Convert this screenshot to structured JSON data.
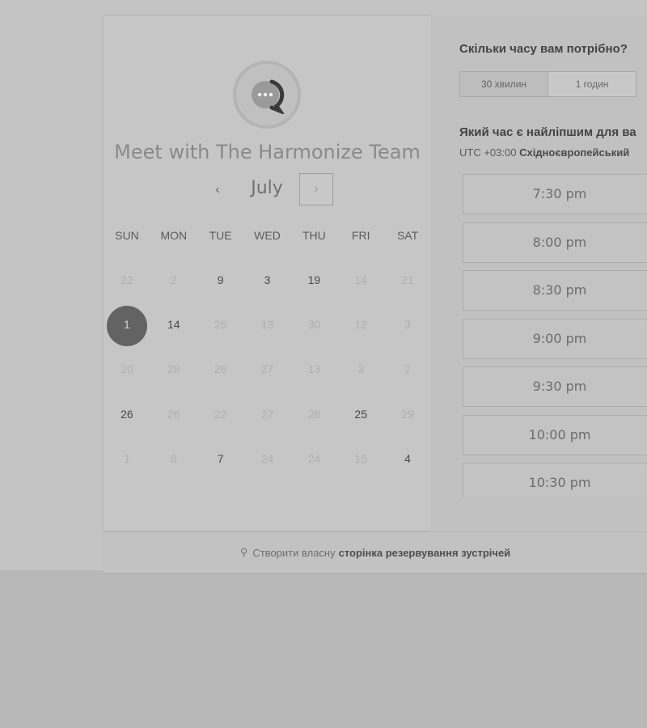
{
  "meeting": {
    "title": "Meet with The Harmonize Team"
  },
  "calendar": {
    "month": "July",
    "prev_label": "‹",
    "next_label": "›",
    "weekdays": [
      "SUN",
      "MON",
      "TUE",
      "WED",
      "THU",
      "FRI",
      "SAT"
    ],
    "weeks": [
      [
        {
          "d": "22",
          "f": true
        },
        {
          "d": "2",
          "f": true
        },
        {
          "d": "9",
          "f": false
        },
        {
          "d": "3",
          "f": false
        },
        {
          "d": "19",
          "f": false
        },
        {
          "d": "14",
          "f": true
        },
        {
          "d": "21",
          "f": true
        }
      ],
      [
        {
          "d": "1",
          "f": false,
          "sel": true
        },
        {
          "d": "14",
          "f": false
        },
        {
          "d": "25",
          "f": true
        },
        {
          "d": "13",
          "f": true
        },
        {
          "d": "30",
          "f": true
        },
        {
          "d": "12",
          "f": true
        },
        {
          "d": "3",
          "f": true
        }
      ],
      [
        {
          "d": "20",
          "f": true
        },
        {
          "d": "28",
          "f": true
        },
        {
          "d": "26",
          "f": true
        },
        {
          "d": "27",
          "f": true
        },
        {
          "d": "13",
          "f": true
        },
        {
          "d": "3",
          "f": true
        },
        {
          "d": "2",
          "f": true
        }
      ],
      [
        {
          "d": "26",
          "f": false
        },
        {
          "d": "26",
          "f": true
        },
        {
          "d": "22",
          "f": true
        },
        {
          "d": "27",
          "f": true
        },
        {
          "d": "28",
          "f": true
        },
        {
          "d": "25",
          "f": false
        },
        {
          "d": "29",
          "f": true
        }
      ],
      [
        {
          "d": "1",
          "f": true
        },
        {
          "d": "8",
          "f": true
        },
        {
          "d": "7",
          "f": false
        },
        {
          "d": "24",
          "f": true
        },
        {
          "d": "24",
          "f": true
        },
        {
          "d": "15",
          "f": true
        },
        {
          "d": "4",
          "f": false
        }
      ]
    ]
  },
  "duration": {
    "question": "Скільки часу вам потрібно?",
    "options": [
      "30 хвилин",
      "1 годин"
    ],
    "selected": "30 хвилин"
  },
  "times": {
    "question": "Який час є найліпшим для ва",
    "tz_offset": "UTC +03:00",
    "tz_name": "Східноєвропейський",
    "slots": [
      "7:30 pm",
      "8:00 pm",
      "8:30 pm",
      "9:00 pm",
      "9:30 pm",
      "10:00 pm",
      "10:30 pm"
    ]
  },
  "footer": {
    "prefix": "Створити власну",
    "link": "сторінка резервування зустрічей",
    "icon": "hubspot-sprocket-icon"
  }
}
